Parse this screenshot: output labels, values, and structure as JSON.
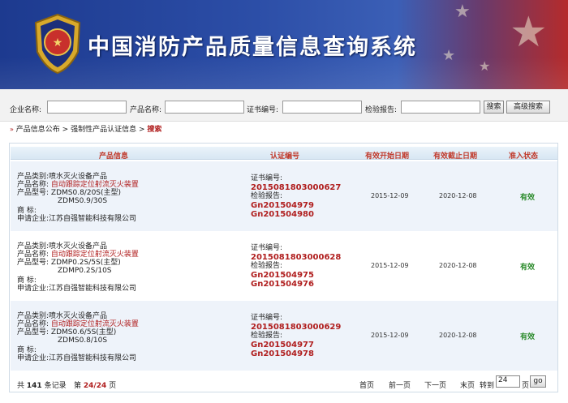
{
  "header": {
    "site_title": "中国消防产品质量信息查询系统"
  },
  "search": {
    "company_label": "企业名称:",
    "product_label": "产品名称:",
    "cert_label": "证书编号:",
    "report_label": "检验报告:",
    "search_button": "搜索",
    "advanced_button": "高级搜索"
  },
  "breadcrumb": {
    "root": "产品信息公布",
    "sep1": ">",
    "mid": "强制性产品认证信息",
    "sep2": ">",
    "current": "搜索"
  },
  "table": {
    "headers": [
      "产品信息",
      "认证编号",
      "有效开始日期",
      "有效截止日期",
      "准入状态"
    ],
    "rows": [
      {
        "category_label": "产品类别:",
        "category": "喷水灭火设备产品",
        "name_label": "产品名称:",
        "name": "自动跟踪定位射流灭火装置",
        "model_label": "产品型号:",
        "model1": "ZDMS0.8/20S(主型)",
        "model2": "ZDMS0.9/30S",
        "brand_label": "商      标:",
        "company_label": "申请企业:",
        "company": "江苏自强智能科技有限公司",
        "cert_label": "证书编号:",
        "cert_no": "2015081803000627",
        "report_label": "检验报告:",
        "report1": "Gn201504979",
        "report2": "Gn201504980",
        "start": "2015-12-09",
        "end": "2020-12-08",
        "status": "有效"
      },
      {
        "category_label": "产品类别:",
        "category": "喷水灭火设备产品",
        "name_label": "产品名称:",
        "name": "自动跟踪定位射流灭火装置",
        "model_label": "产品型号:",
        "model1": "ZDMP0.2S/5S(主型)",
        "model2": "ZDMP0.2S/10S",
        "brand_label": "商      标:",
        "company_label": "申请企业:",
        "company": "江苏自强智能科技有限公司",
        "cert_label": "证书编号:",
        "cert_no": "2015081803000628",
        "report_label": "检验报告:",
        "report1": "Gn201504975",
        "report2": "Gn201504976",
        "start": "2015-12-09",
        "end": "2020-12-08",
        "status": "有效"
      },
      {
        "category_label": "产品类别:",
        "category": "喷水灭火设备产品",
        "name_label": "产品名称:",
        "name": "自动跟踪定位射流灭火装置",
        "model_label": "产品型号:",
        "model1": "ZDMS0.6/5S(主型)",
        "model2": "ZDMS0.8/10S",
        "brand_label": "商      标:",
        "company_label": "申请企业:",
        "company": "江苏自强智能科技有限公司",
        "cert_label": "证书编号:",
        "cert_no": "2015081803000629",
        "report_label": "检验报告:",
        "report1": "Gn201504977",
        "report2": "Gn201504978",
        "start": "2015-12-09",
        "end": "2020-12-08",
        "status": "有效"
      }
    ]
  },
  "pagination": {
    "total_prefix": "共",
    "total": "141",
    "total_suffix": "条记录",
    "page_prefix": "第",
    "page": "24/24",
    "page_suffix": "页",
    "first": "首页",
    "prev": "前一页",
    "next": "下一页",
    "last": "末页",
    "goto_label": "转到",
    "goto_value": "24",
    "goto_suffix": "页",
    "go": "go"
  },
  "colors": {
    "accent_red": "#b01e1e",
    "status_green": "#2a8a2a",
    "banner_blue": "#2c4ea7"
  }
}
